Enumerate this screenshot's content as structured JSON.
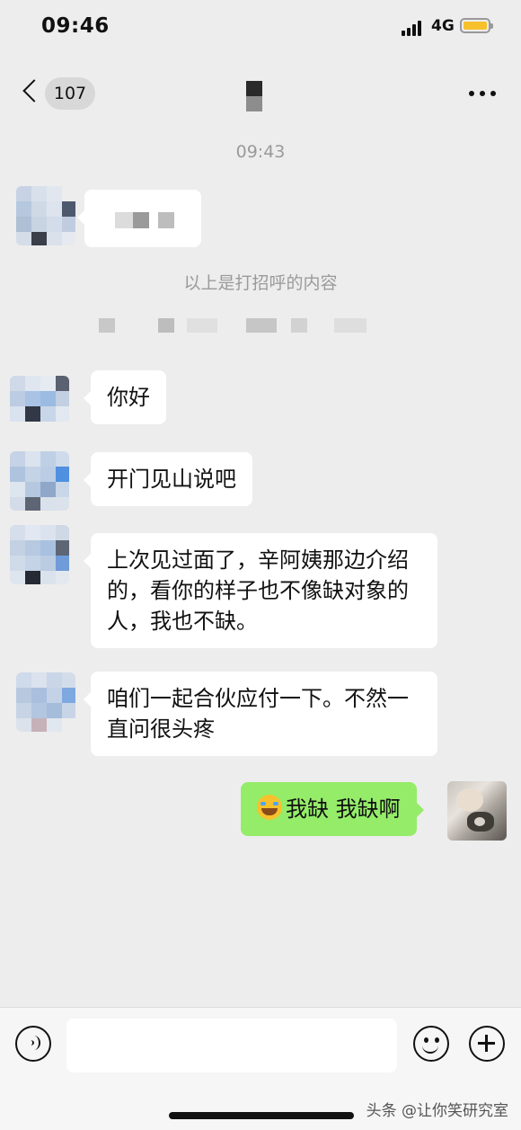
{
  "status_bar": {
    "time": "09:46",
    "network": "4G",
    "battery_color": "#f7c12c"
  },
  "nav": {
    "unread_count": "107",
    "back_icon": "chevron-left-icon",
    "more_icon": "more-dots-icon"
  },
  "chat": {
    "timestamp": "09:43",
    "system_notice": "以上是打招呼的内容",
    "messages": [
      {
        "side": "left",
        "text": "你好"
      },
      {
        "side": "left",
        "text": "开门见山说吧"
      },
      {
        "side": "left",
        "text": "上次见过面了，辛阿姨那边介绍的，看你的样子也不像缺对象的人，我也不缺。"
      },
      {
        "side": "left",
        "text": "咱们一起合伙应付一下。不然一直问很头疼"
      },
      {
        "side": "right",
        "emoji": "laughing-crying-emoji",
        "text": "我缺 我缺啊"
      }
    ]
  },
  "input_bar": {
    "placeholder": "",
    "voice_icon": "voice-icon",
    "emoji_icon": "smiley-icon",
    "plus_icon": "plus-circle-icon"
  },
  "watermark": "头条 @让你笑研究室",
  "colors": {
    "background": "#ededed",
    "bubble_left": "#ffffff",
    "bubble_right": "#95ec69",
    "system_text": "#9a9a9a"
  }
}
